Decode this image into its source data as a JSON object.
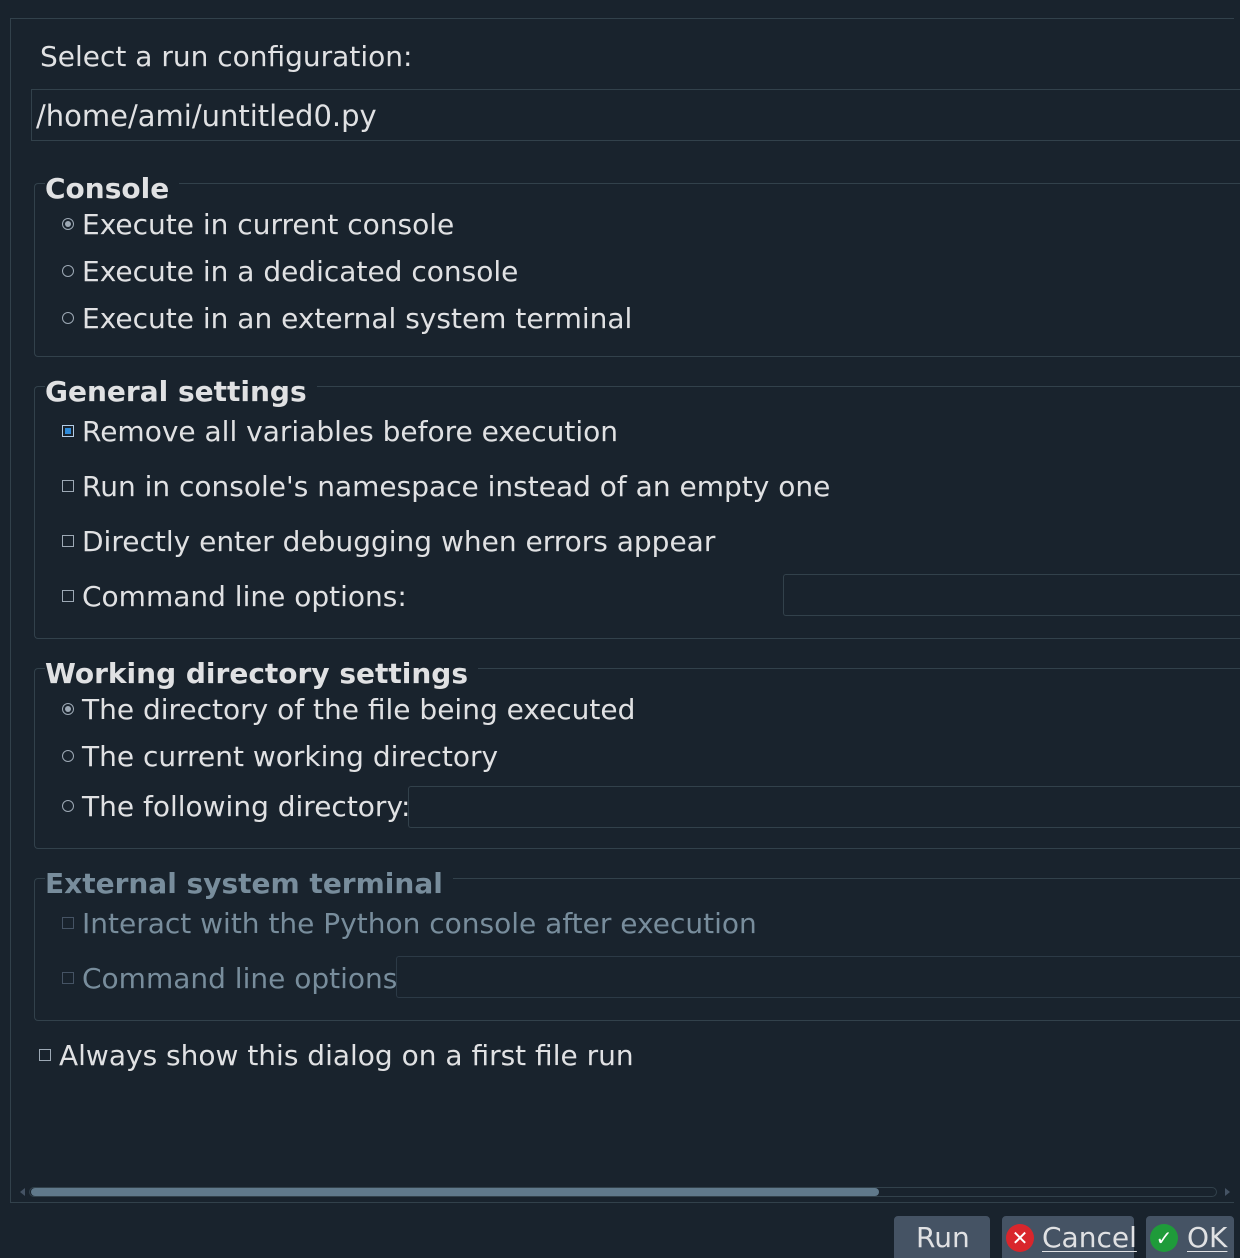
{
  "header": {
    "select_label": "Select a run configuration:"
  },
  "config_combo": {
    "value": "/home/ami/untitled0.py"
  },
  "console": {
    "title": "Console",
    "options": [
      {
        "label": "Execute in current console",
        "checked": true
      },
      {
        "label": "Execute in a dedicated console",
        "checked": false
      },
      {
        "label": "Execute in an external system terminal",
        "checked": false
      }
    ]
  },
  "general": {
    "title": "General settings",
    "remove_vars": "Remove all variables before execution",
    "run_namespace": "Run in console's namespace instead of an empty one",
    "debug_errors": "Directly enter debugging when errors appear",
    "cmd_options": "Command line options:",
    "cmd_options_value": ""
  },
  "workdir": {
    "title": "Working directory settings",
    "file_dir": "The directory of the file being executed",
    "cwd": "The current working directory",
    "following": "The following directory:",
    "following_value": ""
  },
  "external": {
    "title": "External system terminal",
    "interact": "Interact with the Python console after execution",
    "cmd_options": "Command line options:",
    "cmd_options_value": ""
  },
  "always_show": "Always show this dialog on a first file run",
  "buttons": {
    "run": "Run",
    "cancel": "Cancel",
    "ok": "OK"
  },
  "colors": {
    "background": "#19232d",
    "border": "#32414b",
    "accent": "#2d8ad9",
    "button": "#455364"
  }
}
